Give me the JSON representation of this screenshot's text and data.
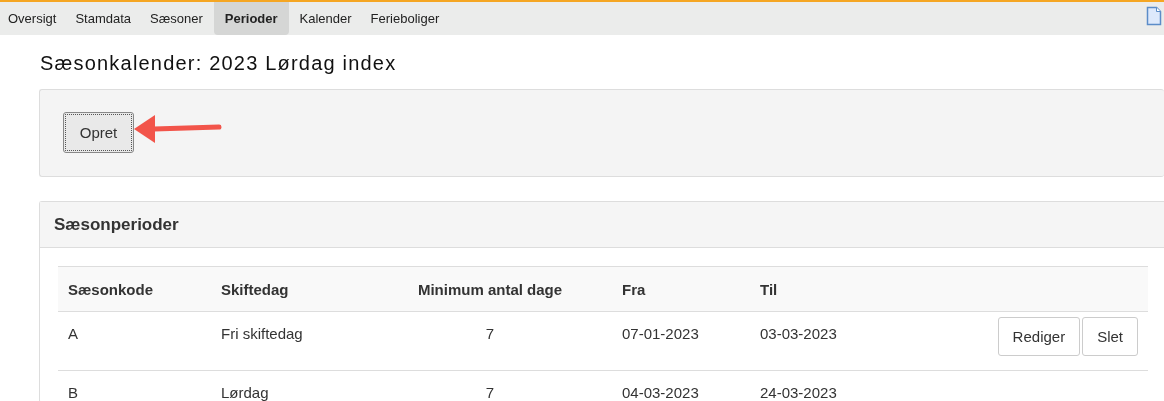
{
  "nav_tabs": [
    {
      "label": "Oversigt",
      "selected": false
    },
    {
      "label": "Stamdata",
      "selected": false
    },
    {
      "label": "Sæsoner",
      "selected": false
    },
    {
      "label": "Perioder",
      "selected": true
    },
    {
      "label": "Kalender",
      "selected": false
    },
    {
      "label": "Ferieboliger",
      "selected": false
    }
  ],
  "page_title": "Sæsonkalender: 2023 Lørdag index",
  "create_button": "Opret",
  "periods_panel": {
    "title": "Sæsonperioder",
    "columns": [
      "Sæsonkode",
      "Skiftedag",
      "Minimum antal dage",
      "Fra",
      "Til"
    ],
    "rows": [
      {
        "cells": [
          "A",
          "Fri skiftedag",
          "7",
          "07-01-2023",
          "03-03-2023"
        ],
        "actions": [
          "Rediger",
          "Slet"
        ]
      },
      {
        "cells": [
          "B",
          "Lørdag",
          "7",
          "04-03-2023",
          "24-03-2023"
        ]
      }
    ]
  }
}
